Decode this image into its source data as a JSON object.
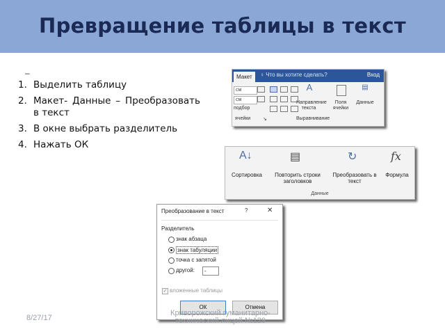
{
  "slide": {
    "title": "Превращение таблицы в текст",
    "dash": "–",
    "steps": [
      {
        "num": "1.",
        "text": "Выделить таблицу"
      },
      {
        "num": "2.",
        "text": "Макет- Данные – Преобразовать в текст"
      },
      {
        "num": "3.",
        "text": "В окне выбрать разделитель"
      },
      {
        "num": "4.",
        "text": "Нажать ОК"
      }
    ],
    "date": "8/27/17",
    "org": "Криворожский гуманитарно-технический лицей №129"
  },
  "ribbon_layout": {
    "tab": "Макет",
    "tell_me": "♀ Что вы хотите сделать?",
    "login": "Вход",
    "field1": "см",
    "field2": "см",
    "autofit": "подбор",
    "group1": "ячейки",
    "group2": "Выравнивание",
    "direction": "Направление текста",
    "margins": "Поля ячейки",
    "data": "Данные"
  },
  "ribbon_data": {
    "sort": "Сортировка",
    "repeat": "Повторить строки заголовков",
    "convert": "Преобразовать в текст",
    "formula": "Формула",
    "group": "Данные",
    "fx": "fx"
  },
  "dialog": {
    "title": "Преобразование в текст",
    "help": "?",
    "close": "✕",
    "group": "Разделитель",
    "options": [
      {
        "label": "знак абзаца",
        "selected": false
      },
      {
        "label": "знак табуляции",
        "selected": true
      },
      {
        "label": "точка с запятой",
        "selected": false
      },
      {
        "label": "другой:",
        "selected": false
      }
    ],
    "other_value": "-",
    "nested": "вложенные таблицы",
    "nested_checked": true,
    "ok": "ОК",
    "cancel": "Отмена"
  }
}
